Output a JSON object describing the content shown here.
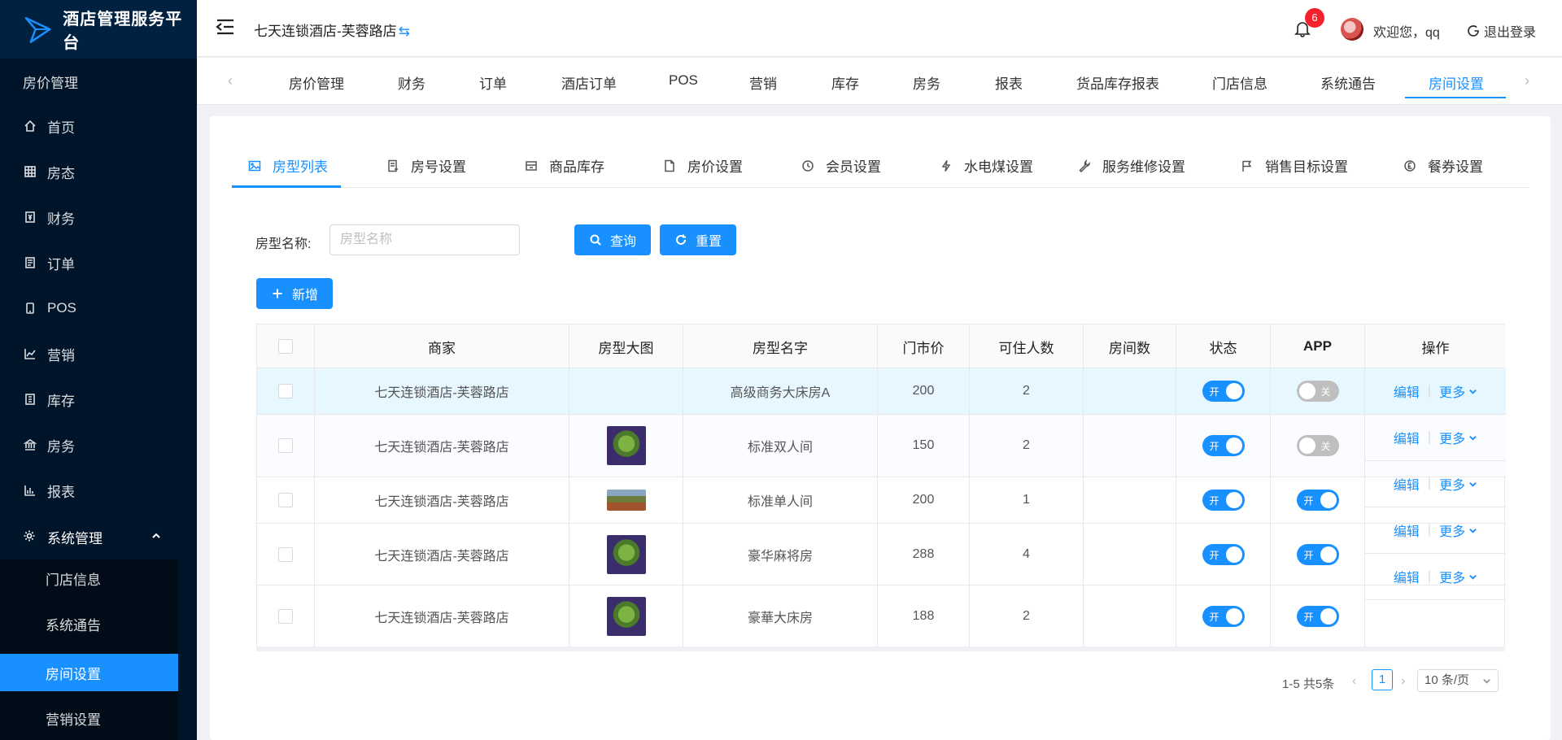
{
  "app": {
    "title": "酒店管理服务平台"
  },
  "sidebar": {
    "section_title": "房价管理",
    "items": [
      {
        "label": "首页",
        "icon": "home-icon"
      },
      {
        "label": "房态",
        "icon": "grid-icon"
      },
      {
        "label": "财务",
        "icon": "finance-icon"
      },
      {
        "label": "订单",
        "icon": "order-icon"
      },
      {
        "label": "POS",
        "icon": "pos-icon"
      },
      {
        "label": "营销",
        "icon": "chart-line-icon"
      },
      {
        "label": "库存",
        "icon": "inventory-icon"
      },
      {
        "label": "房务",
        "icon": "bank-icon"
      },
      {
        "label": "报表",
        "icon": "bar-chart-icon"
      }
    ],
    "system": {
      "label": "系统管理",
      "icon": "gear-icon"
    },
    "sub_items": [
      {
        "label": "门店信息"
      },
      {
        "label": "系统通告"
      },
      {
        "label": "房间设置",
        "active": true
      },
      {
        "label": "营销设置"
      }
    ]
  },
  "header": {
    "store_name": "七天连锁酒店-芙蓉路店",
    "swap_glyph": "⇆",
    "notification_count": "6",
    "welcome": "欢迎您，qq",
    "logout": "退出登录"
  },
  "topnav": {
    "tabs": [
      "房价管理",
      "财务",
      "订单",
      "酒店订单",
      "POS",
      "营销",
      "库存",
      "房务",
      "报表",
      "货品库存报表",
      "门店信息",
      "系统通告",
      "房间设置"
    ],
    "active": "房间设置"
  },
  "subtabs": {
    "items": [
      "房型列表",
      "房号设置",
      "商品库存",
      "房价设置",
      "会员设置",
      "水电煤设置",
      "服务维修设置",
      "销售目标设置",
      "餐券设置"
    ],
    "active": "房型列表"
  },
  "filter": {
    "label": "房型名称:",
    "placeholder": "房型名称",
    "value": "",
    "search": "查询",
    "reset": "重置",
    "add": "新增"
  },
  "table": {
    "columns": [
      "商家",
      "房型大图",
      "房型名字",
      "门市价",
      "可住人数",
      "房间数",
      "状态",
      "APP",
      "操作"
    ],
    "rows": [
      {
        "merchant": "七天连锁酒店-芙蓉路店",
        "image": "",
        "name": "高级商务大床房A",
        "price": "200",
        "capacity": "2",
        "rooms": "",
        "status": "开",
        "status_on": true,
        "app": "关",
        "app_on": false
      },
      {
        "merchant": "七天连锁酒店-芙蓉路店",
        "image": "frog-thumbnail",
        "name": "标准双人间",
        "price": "150",
        "capacity": "2",
        "rooms": "",
        "status": "开",
        "status_on": true,
        "app": "关",
        "app_on": false
      },
      {
        "merchant": "七天连锁酒店-芙蓉路店",
        "image": "landscape-thumbnail",
        "name": "标准单人间",
        "price": "200",
        "capacity": "1",
        "rooms": "",
        "status": "开",
        "status_on": true,
        "app": "开",
        "app_on": true
      },
      {
        "merchant": "七天连锁酒店-芙蓉路店",
        "image": "frog-thumbnail",
        "name": "豪华麻将房",
        "price": "288",
        "capacity": "4",
        "rooms": "",
        "status": "开",
        "status_on": true,
        "app": "开",
        "app_on": true
      },
      {
        "merchant": "七天连锁酒店-芙蓉路店",
        "image": "frog-thumbnail",
        "name": "豪華大床房",
        "price": "188",
        "capacity": "2",
        "rooms": "",
        "status": "开",
        "status_on": true,
        "app": "开",
        "app_on": true
      }
    ],
    "edit": "编辑",
    "more": "更多",
    "divider": "|"
  },
  "pagination": {
    "total": "1-5 共5条",
    "current": "1",
    "page_size": "10 条/页",
    "prev": "‹",
    "next": "›"
  },
  "colors": {
    "primary": "#1890ff",
    "sidebar": "#001529",
    "badge": "#f5222d"
  }
}
